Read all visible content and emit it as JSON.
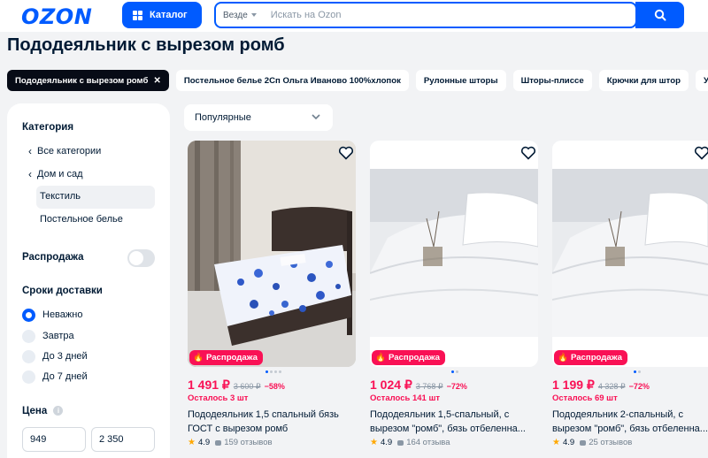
{
  "header": {
    "logo": "OZON",
    "catalog_label": "Каталог",
    "search_scope": "Везде",
    "search_placeholder": "Искать на Ozon"
  },
  "page_title": "Пододеяльник с вырезом ромб",
  "chips": [
    {
      "label": "Пододеяльник с вырезом ромб",
      "active": true
    },
    {
      "label": "Постельное белье 2Сп Ольга Иваново 100%хлопок"
    },
    {
      "label": "Рулонные шторы"
    },
    {
      "label": "Шторы-плиссе"
    },
    {
      "label": "Крючки для штор"
    },
    {
      "label": "Утяжел"
    }
  ],
  "sidebar": {
    "category_title": "Категория",
    "categories": [
      "Все категории",
      "Дом и сад",
      "Текстиль",
      "Постельное белье"
    ],
    "sale_label": "Распродажа",
    "delivery_title": "Сроки доставки",
    "delivery_options": [
      "Неважно",
      "Завтра",
      "До 3 дней",
      "До 7 дней"
    ],
    "price_title": "Цена",
    "price_from": "949",
    "price_to": "2 350"
  },
  "sort": {
    "label": "Популярные"
  },
  "products": [
    {
      "badge": "Распродажа",
      "price": "1 491 ₽",
      "old_price": "3 600 ₽",
      "discount": "−58%",
      "stock": "Осталось 3 шт",
      "name": "Пододеяльник 1,5 спальный бязь ГОСТ с вырезом ромб",
      "rating": "4.9",
      "reviews": "159 отзывов"
    },
    {
      "badge": "Распродажа",
      "price": "1 024 ₽",
      "old_price": "3 768 ₽",
      "discount": "−72%",
      "stock": "Осталось 141 шт",
      "name": "Пододеяльник 1,5-спальный, с вырезом \"ромб\", бязь отбеленна...",
      "rating": "4.9",
      "reviews": "164 отзыва"
    },
    {
      "badge": "Распродажа",
      "price": "1 199 ₽",
      "old_price": "4 328 ₽",
      "discount": "−72%",
      "stock": "Осталось 69 шт",
      "name": "Пододеяльник 2-спальный, с вырезом \"ромб\", бязь отбеленна...",
      "rating": "4.9",
      "reviews": "25 отзывов"
    }
  ],
  "colors": {
    "brand": "#005bff",
    "sale": "#f91155",
    "star": "#ffa800"
  }
}
